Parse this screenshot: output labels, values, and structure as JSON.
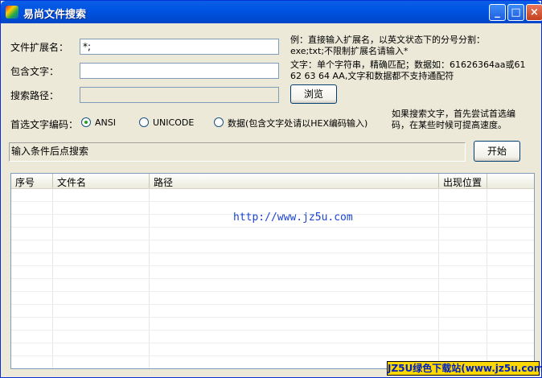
{
  "window": {
    "title": "易尚文件搜索",
    "min_glyph": "_",
    "max_glyph": "□",
    "close_glyph": "×"
  },
  "form": {
    "ext_label": "文件扩展名：",
    "ext_value": "*;",
    "ext_hint_1": "例：直接输入扩展名，以英文状态下的分号分割：",
    "ext_hint_2": "exe;txt;不限制扩展名请输入*",
    "contain_label": "包含文字：",
    "contain_value": "",
    "contain_hint_1": "文字：单个字符串，精确匹配；数据如：61626364aa或61",
    "contain_hint_2": "62 63 64 AA,文字和数据都不支持通配符",
    "path_label": "搜索路径：",
    "path_value": "",
    "browse_button": "浏览"
  },
  "encoding": {
    "label": "首选文字编码：",
    "options": [
      {
        "label": "ANSI",
        "selected": true
      },
      {
        "label": "UNICODE",
        "selected": false
      },
      {
        "label": "数据(包含文字处请以HEX编码输入)",
        "selected": false
      }
    ],
    "note_1": "如果搜索文字，首先尝试首选编",
    "note_2": "码，在某些时候可提高速度。"
  },
  "status_text": "输入条件后点搜索",
  "start_button": "开始",
  "results": {
    "columns": [
      "序号",
      "文件名",
      "路径",
      "出现位置"
    ],
    "overlay_url": "http://www.jz5u.com"
  },
  "watermark": "JZ5U绿色下载站(www.jz5u.com)"
}
